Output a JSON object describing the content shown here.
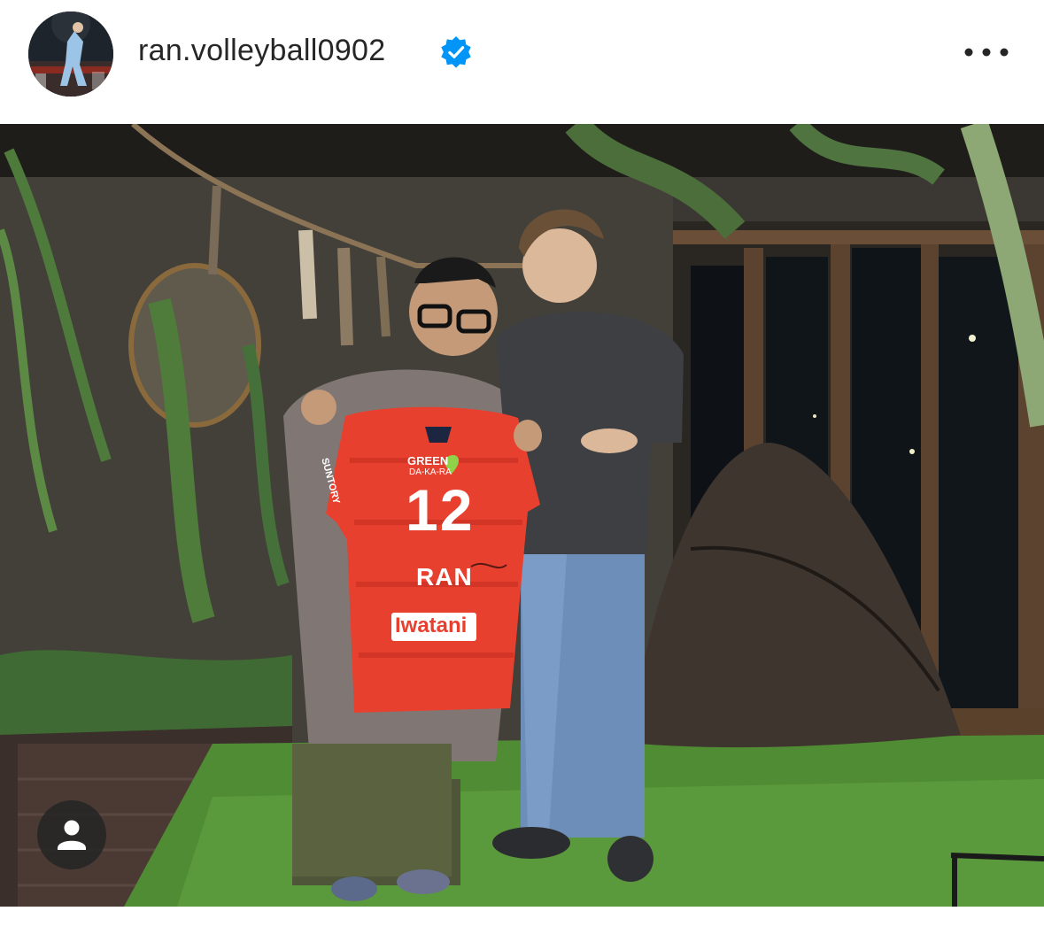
{
  "post": {
    "username": "ran.volleyball0902",
    "verified": true,
    "avatar_icon": "profile-avatar-icon",
    "more_icon": "more-options-icon",
    "tag_icon": "user-tag-icon"
  },
  "jersey": {
    "number": "12",
    "name": "RAN",
    "sponsor": "Iwatani",
    "chest_line1": "GREEN",
    "chest_line2": "DA-KA-RA",
    "sleeve": "SUNTORY"
  },
  "colors": {
    "verified_blue": "#0095f6",
    "jersey_red": "#e8402f",
    "text_dark": "#262626"
  }
}
